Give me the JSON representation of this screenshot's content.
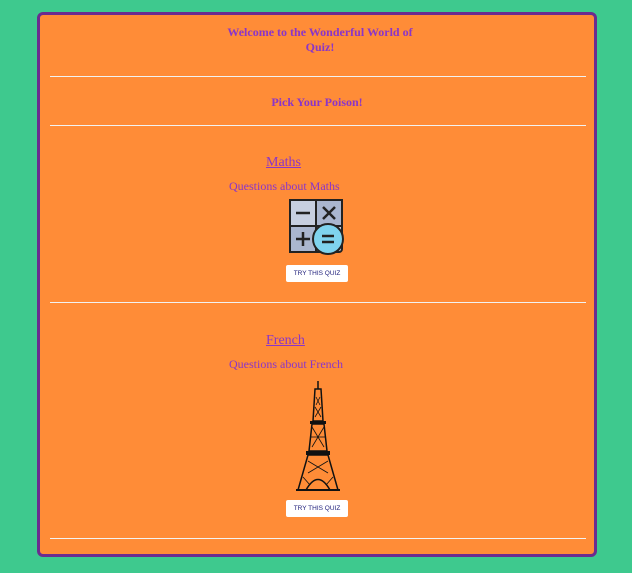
{
  "header": {
    "title": "Welcome to the Wonderful World of Quiz!",
    "subtitle": "Pick Your Poison!"
  },
  "quizzes": [
    {
      "name": "Maths",
      "description": "Questions about Maths",
      "button_label": "TRY THIS QUIZ",
      "icon": "calculator-icon"
    },
    {
      "name": "French",
      "description": "Questions about French",
      "button_label": "TRY THIS QUIZ",
      "icon": "eiffel-tower-icon"
    }
  ],
  "colors": {
    "background": "#3ec98e",
    "card": "#ff8c37",
    "border": "#6b2c8f",
    "text": "#8a35c9"
  }
}
